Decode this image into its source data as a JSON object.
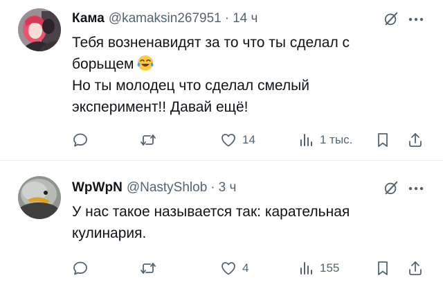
{
  "tweets": [
    {
      "author": {
        "name": "Кама",
        "handle": "@kamaksin267951"
      },
      "separator": "·",
      "time": "14 ч",
      "text_lines": [
        "Тебя возненавидят за то что ты сделал с",
        "борьщем",
        "Но ты молодец что сделал смелый",
        "эксперимент!! Давай ещё!"
      ],
      "emoji_icon": "face-with-tears-of-joy-emoji",
      "stats": {
        "likes": "14",
        "views": "1 тыс."
      }
    },
    {
      "author": {
        "name": "WpWpN",
        "handle": "@NastyShlob"
      },
      "separator": "·",
      "time": "3 ч",
      "text_lines": [
        "У нас такое называется так: карательная",
        "кулинария."
      ],
      "stats": {
        "likes": "4",
        "views": "155"
      }
    }
  ],
  "colors": {
    "text": "#0f1419",
    "secondary": "#536471",
    "divider": "#e6ecf0",
    "emoji": "#ffc83d"
  }
}
